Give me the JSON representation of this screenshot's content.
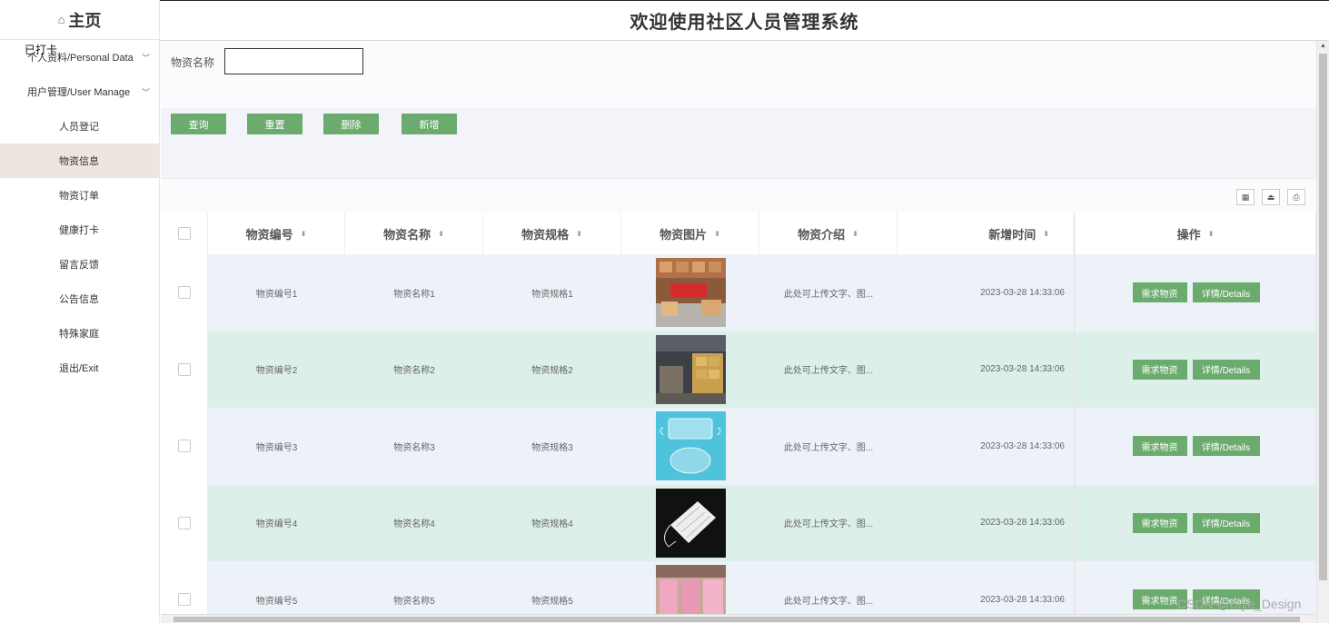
{
  "sidebar": {
    "home_icon": "home-icon",
    "home_label": "主页",
    "overlap_text": "已打卡",
    "groups": [
      {
        "label": "个人资料/Personal Data"
      },
      {
        "label": "用户管理/User Manage"
      }
    ],
    "items": [
      {
        "label": "人员登记"
      },
      {
        "label": "物资信息"
      },
      {
        "label": "物资订单"
      },
      {
        "label": "健康打卡"
      },
      {
        "label": "留言反馈"
      },
      {
        "label": "公告信息"
      },
      {
        "label": "特殊家庭"
      },
      {
        "label": "退出/Exit"
      }
    ]
  },
  "header": {
    "title": "欢迎使用社区人员管理系统"
  },
  "search": {
    "label": "物资名称",
    "value": ""
  },
  "actions": {
    "query": "查询",
    "reset": "重置",
    "delete": "删除",
    "add": "新增"
  },
  "table": {
    "columns": [
      "物资编号",
      "物资名称",
      "物资规格",
      "物资图片",
      "物资介绍",
      "新增时间",
      "操作"
    ],
    "rows": [
      {
        "code": "物资编号1",
        "name": "物资名称1",
        "spec": "物资规格1",
        "intro": "此处可上传文字、图...",
        "time": "2023-03-28 14:33:06"
      },
      {
        "code": "物资编号2",
        "name": "物资名称2",
        "spec": "物资规格2",
        "intro": "此处可上传文字、图...",
        "time": "2023-03-28 14:33:06"
      },
      {
        "code": "物资编号3",
        "name": "物资名称3",
        "spec": "物资规格3",
        "intro": "此处可上传文字、图...",
        "time": "2023-03-28 14:33:06"
      },
      {
        "code": "物资编号4",
        "name": "物资名称4",
        "spec": "物资规格4",
        "intro": "此处可上传文字、图...",
        "time": "2023-03-28 14:33:06"
      },
      {
        "code": "物资编号5",
        "name": "物资名称5",
        "spec": "物资规格5",
        "intro": "此处可上传文字、图...",
        "time": "2023-03-28 14:33:06"
      }
    ],
    "row_actions": {
      "need": "需求物资",
      "detail": "详情/Details"
    }
  },
  "watermark": "CSDN @Biye_Design"
}
